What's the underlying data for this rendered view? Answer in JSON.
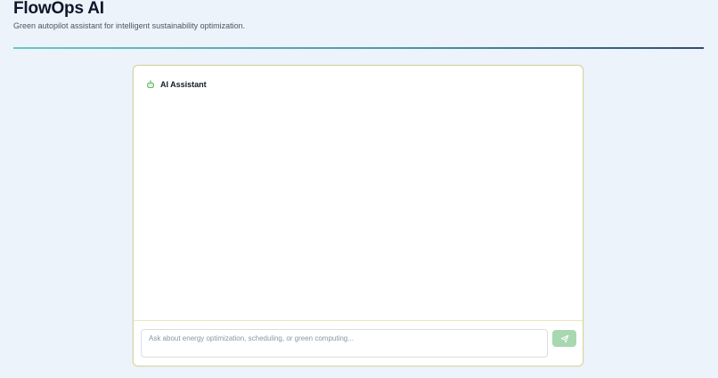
{
  "header": {
    "title": "FlowOps AI",
    "subtitle": "Green autopilot assistant for intelligent sustainability optimization."
  },
  "chat": {
    "title": "AI Assistant",
    "input": {
      "value": "",
      "placeholder": "Ask about energy optimization, scheduling, or green computing..."
    }
  },
  "icons": {
    "assistant": "bot-icon",
    "send": "send-icon"
  },
  "colors": {
    "page_background": "#edf3fb",
    "accent_green": "#4caf50",
    "send_button": "#a8d8b0",
    "card_border": "#d8d39c",
    "divider_start": "#67c9c2",
    "divider_end": "#2f4d6f"
  }
}
